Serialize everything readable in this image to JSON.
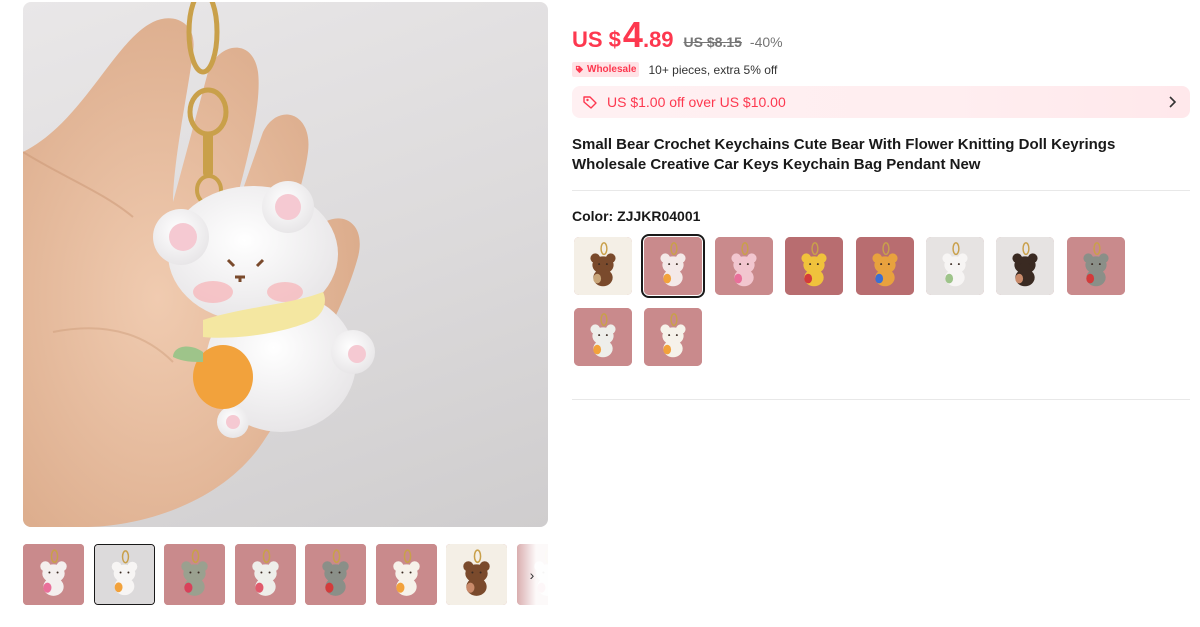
{
  "product": {
    "price_prefix": "US $",
    "price_integer": "4",
    "price_decimal": ".89",
    "original_price": "US $8.15",
    "discount": "-40%",
    "wholesale_badge": "Wholesale",
    "wholesale_text": "10+ pieces, extra 5% off",
    "coupon_text": "US $1.00 off over US $10.00",
    "title": "Small Bear Crochet Keychains Cute Bear With Flower Knitting Doll Keyrings Wholesale Creative Car Keys Keychain Bag Pendant New",
    "color_label": "Color: ",
    "color_value": "ZJJKR04001"
  },
  "gallery": {
    "main_image": "white crochet bear keychain held in hand",
    "thumbnails": [
      {
        "name": "bear-pink-flower",
        "bg": "#c98a8c",
        "body": "#f4efee",
        "accent": "#e96f9a",
        "selected": false
      },
      {
        "name": "bear-hand-held",
        "bg": "#dcdadb",
        "body": "#f7f5f4",
        "accent": "#f2a23c",
        "selected": true
      },
      {
        "name": "bear-group",
        "bg": "#c98a8c",
        "body": "#9aa08f",
        "accent": "#d9405a",
        "selected": false
      },
      {
        "name": "bear-group-2",
        "bg": "#c98a8c",
        "body": "#eeeeea",
        "accent": "#e05a6c",
        "selected": false
      },
      {
        "name": "bear-gray",
        "bg": "#c98a8c",
        "body": "#8a8f88",
        "accent": "#d33b3b",
        "selected": false
      },
      {
        "name": "bunny-white",
        "bg": "#c98a8c",
        "body": "#f6f2ea",
        "accent": "#f2a23c",
        "selected": false
      },
      {
        "name": "bear-brown",
        "bg": "#f4efe6",
        "body": "#7a4a2c",
        "accent": "#c98a6a",
        "selected": false
      },
      {
        "name": "bear-partial",
        "bg": "#c98a8c",
        "body": "#eeeeea",
        "accent": "#e05a6c",
        "selected": false
      }
    ],
    "next_icon": "chevron-right-icon"
  },
  "variants": [
    {
      "name": "brown-bear",
      "bg": "#f4efe6",
      "body": "#7a4a2c",
      "accent": "#c9a67a",
      "selected": false
    },
    {
      "name": "white-bear-selected",
      "bg": "#c98a8c",
      "body": "#f4e9e8",
      "accent": "#f2a23c",
      "selected": true
    },
    {
      "name": "pink-pig-bear",
      "bg": "#c98a8c",
      "body": "#f2c6cf",
      "accent": "#e96f9a",
      "selected": false
    },
    {
      "name": "yellow-bear",
      "bg": "#b86d70",
      "body": "#f0c23c",
      "accent": "#d33b3b",
      "selected": false
    },
    {
      "name": "tiger-bear",
      "bg": "#b86d70",
      "body": "#e8a23e",
      "accent": "#3b6fd3",
      "selected": false
    },
    {
      "name": "hand-held-bear",
      "bg": "#e6e3e2",
      "body": "#f7f5f4",
      "accent": "#9ec48a",
      "selected": false
    },
    {
      "name": "dark-bear-hand",
      "bg": "#e6e3e2",
      "body": "#3a2a22",
      "accent": "#c98a6a",
      "selected": false
    },
    {
      "name": "gray-bear-rose",
      "bg": "#c98a8c",
      "body": "#8a8f88",
      "accent": "#d33b3b",
      "selected": false
    },
    {
      "name": "white-bear-carrot",
      "bg": "#c98a8c",
      "body": "#eeeeea",
      "accent": "#f2a23c",
      "selected": false
    },
    {
      "name": "white-bunny",
      "bg": "#c98a8c",
      "body": "#f6f2ea",
      "accent": "#f2a23c",
      "selected": false
    }
  ],
  "colors": {
    "price_red": "#fd384f",
    "text_primary": "#191919",
    "text_secondary": "#757575",
    "coupon_bg": "#fff0f2"
  }
}
